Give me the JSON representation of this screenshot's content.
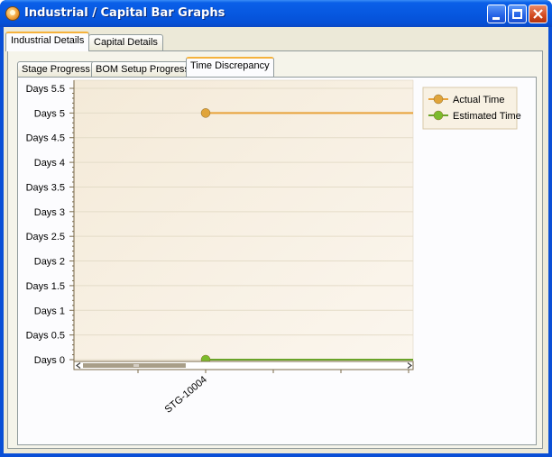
{
  "window": {
    "title": "Industrial / Capital Bar Graphs",
    "accent": "#0a5fe8"
  },
  "outer_tabs": [
    {
      "label": "Industrial Details",
      "active": true
    },
    {
      "label": "Capital Details",
      "active": false
    }
  ],
  "inner_tabs": [
    {
      "label": "Stage Progress",
      "active": false
    },
    {
      "label": "BOM Setup Progress",
      "active": false
    },
    {
      "label": "Time Discrepancy",
      "active": true
    }
  ],
  "icons": {
    "app": "app-icon",
    "minimize": "minimize-icon",
    "maximize": "maximize-icon",
    "close": "close-icon",
    "scroll_left": "scroll-left-icon",
    "scroll_right": "scroll-right-icon"
  },
  "chart_data": {
    "type": "line",
    "categories": [
      "STG-10004"
    ],
    "ylim": [
      0,
      5.5
    ],
    "yticks": [
      {
        "value": 0,
        "label": "Days 0"
      },
      {
        "value": 0.5,
        "label": "Days 0.5"
      },
      {
        "value": 1,
        "label": "Days 1"
      },
      {
        "value": 1.5,
        "label": "Days 1.5"
      },
      {
        "value": 2,
        "label": "Days 2"
      },
      {
        "value": 2.5,
        "label": "Days 2.5"
      },
      {
        "value": 3,
        "label": "Days 3"
      },
      {
        "value": 3.5,
        "label": "Days 3.5"
      },
      {
        "value": 4,
        "label": "Days 4"
      },
      {
        "value": 4.5,
        "label": "Days 4.5"
      },
      {
        "value": 5,
        "label": "Days 5"
      },
      {
        "value": 5.5,
        "label": "Days 5.5"
      }
    ],
    "series": [
      {
        "name": "Actual Time",
        "values": [
          5
        ],
        "color": "#e0a43a",
        "line_color": "#e8a23a"
      },
      {
        "name": "Estimated Time",
        "values": [
          0
        ],
        "color": "#7cbb2c",
        "line_color": "#6aa329"
      }
    ],
    "legend": "top-right",
    "grid": true,
    "scrollbar": {
      "thumb_start": 0,
      "thumb_end": 0.32
    }
  }
}
